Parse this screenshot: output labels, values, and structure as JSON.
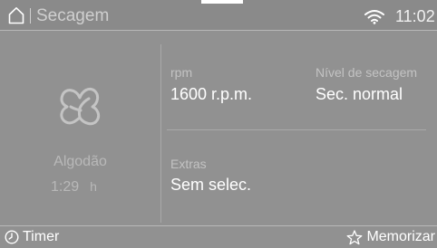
{
  "header": {
    "title": "Secagem",
    "time": "11:02"
  },
  "program": {
    "name": "Algodão",
    "duration": "1:29",
    "duration_unit": "h",
    "icon": "cotton-icon"
  },
  "speed": {
    "label": "rpm",
    "value": "1600 r.p.m."
  },
  "dry_level": {
    "label": "Nível de secagem",
    "value": "Sec. normal"
  },
  "extras": {
    "label": "Extras",
    "value": "Sem selec."
  },
  "footer": {
    "timer_label": "Timer",
    "memorize_label": "Memorizar"
  }
}
